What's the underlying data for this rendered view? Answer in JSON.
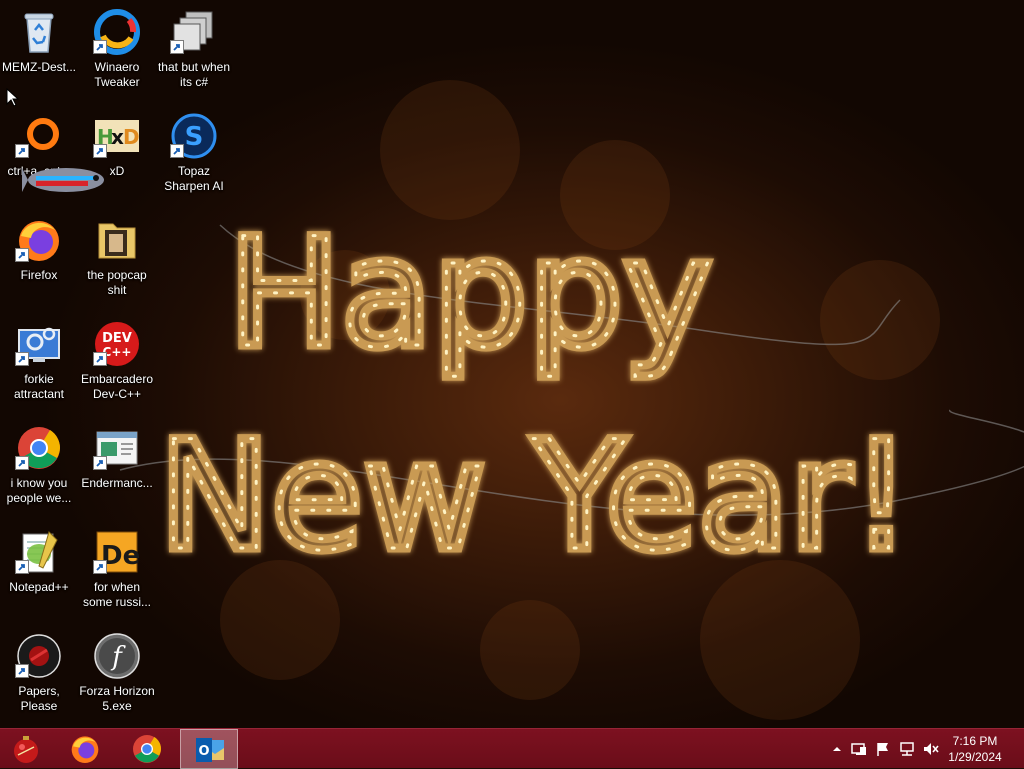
{
  "desktop": {
    "icons": [
      {
        "label": "MEMZ-Dest...",
        "icon": "recycle-bin-icon",
        "shortcut": false
      },
      {
        "label": "Winaero Tweaker",
        "icon": "winaero-icon",
        "shortcut": true
      },
      {
        "label": "that but when its c#",
        "icon": "stacked-windows-icon",
        "shortcut": true
      },
      {
        "label": "ctrl+a, ent...",
        "icon": "orange-ring-icon",
        "shortcut": true
      },
      {
        "label": "xD",
        "icon": "hxd-icon",
        "shortcut": true
      },
      {
        "label": "Topaz Sharpen AI",
        "icon": "topaz-icon",
        "shortcut": true
      },
      {
        "label": "Firefox",
        "icon": "firefox-icon",
        "shortcut": true
      },
      {
        "label": "the popcap shit",
        "icon": "folder-icon",
        "shortcut": false
      },
      {
        "label": "forkie attractant",
        "icon": "settings-monitor-icon",
        "shortcut": true
      },
      {
        "label": "Embarcadero Dev-C++",
        "icon": "devcpp-icon",
        "shortcut": true
      },
      {
        "label": "i know you people we...",
        "icon": "chrome-icon",
        "shortcut": true
      },
      {
        "label": "Endermanc...",
        "icon": "window-app-icon",
        "shortcut": true
      },
      {
        "label": "Notepad++",
        "icon": "notepadpp-icon",
        "shortcut": true
      },
      {
        "label": "for when some russi...",
        "icon": "de-icon",
        "shortcut": true
      },
      {
        "label": "Papers, Please",
        "icon": "papers-please-icon",
        "shortcut": true
      },
      {
        "label": "Forza Horizon 5.exe",
        "icon": "flash-icon",
        "shortcut": true
      }
    ]
  },
  "wallpaper": {
    "text_line1": "Happy",
    "text_line2": "New Year!"
  },
  "taskbar": {
    "start_icon": "ornament-start-icon",
    "pinned": [
      {
        "name": "firefox",
        "icon": "firefox-icon",
        "active": false
      },
      {
        "name": "chrome",
        "icon": "chrome-icon",
        "active": false
      },
      {
        "name": "outlook",
        "icon": "outlook-icon",
        "active": true
      }
    ],
    "tray": [
      "show-hidden-icons-chevron-icon",
      "network-adapter-icon",
      "action-center-flag-icon",
      "network-icon",
      "volume-muted-icon"
    ],
    "time": "7:16 PM",
    "date": "1/29/2024"
  },
  "colors": {
    "taskbar": "#7d1120",
    "wallpaper_dark": "#1a0d06",
    "lights": "#ffd98a"
  }
}
